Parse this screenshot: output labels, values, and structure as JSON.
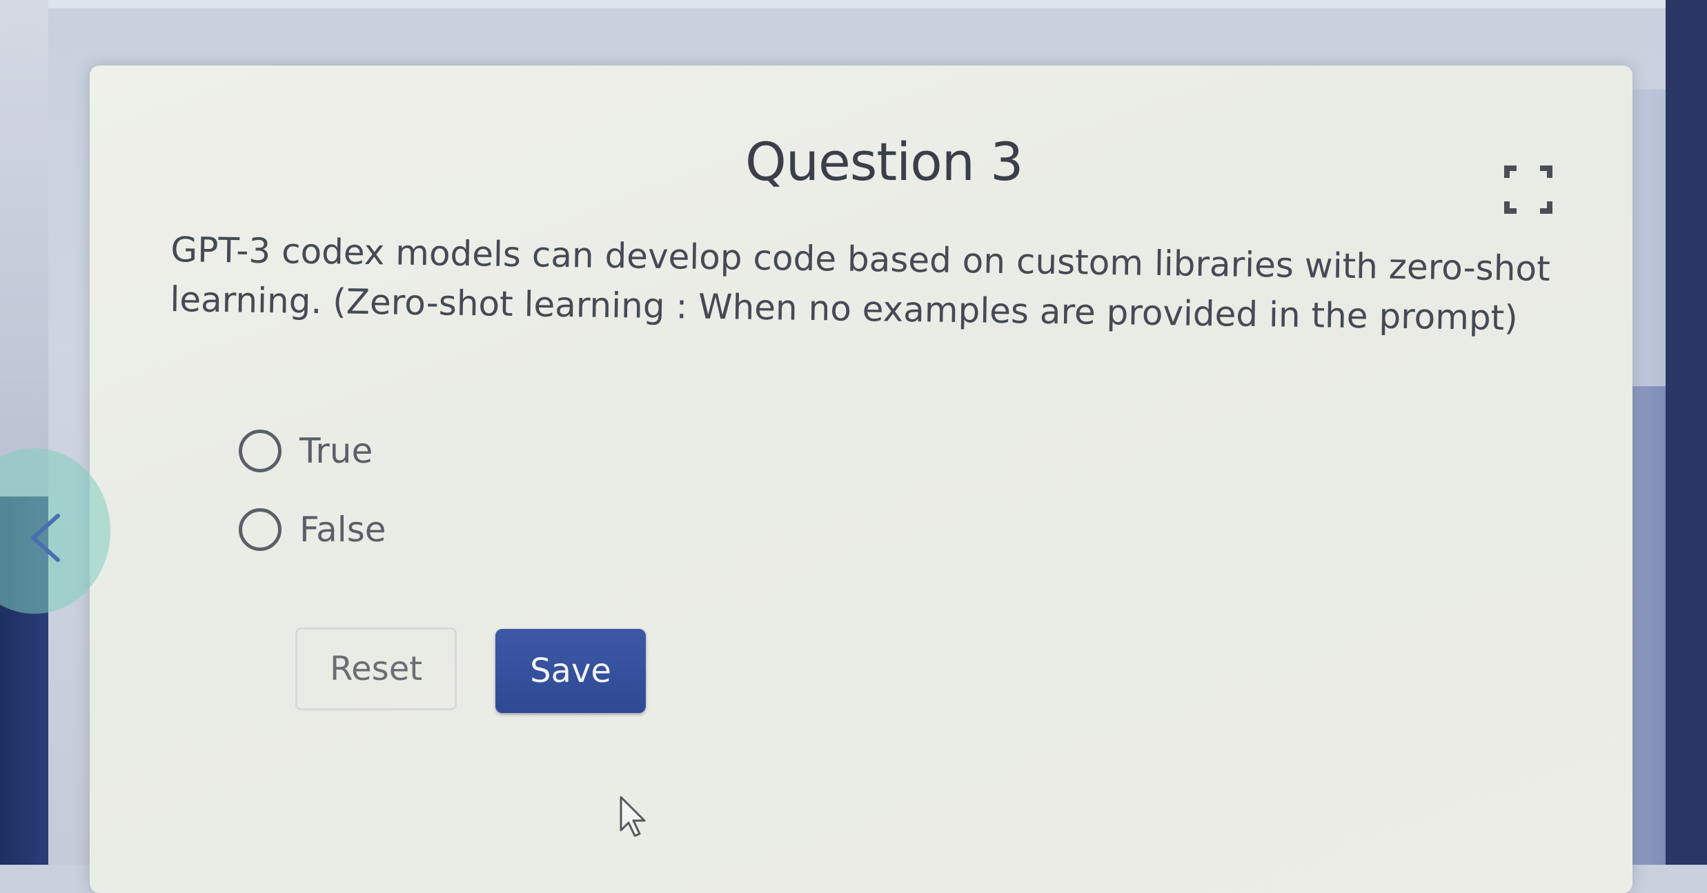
{
  "question": {
    "title": "Question 3",
    "text": "GPT-3 codex models can develop code based on custom libraries with zero-shot learning. (Zero-shot learning : When no examples are provided in the prompt)",
    "options": [
      {
        "label": "True",
        "selected": false
      },
      {
        "label": "False",
        "selected": false
      }
    ]
  },
  "actions": {
    "reset_label": "Reset",
    "save_label": "Save"
  },
  "icons": {
    "expand": "expand-icon",
    "previous": "chevron-left-icon",
    "cursor": "mouse-pointer-icon"
  },
  "colors": {
    "save_button": "#3d58a5",
    "nav_circle": "#80cdbe",
    "card_background": "#eceee8"
  }
}
